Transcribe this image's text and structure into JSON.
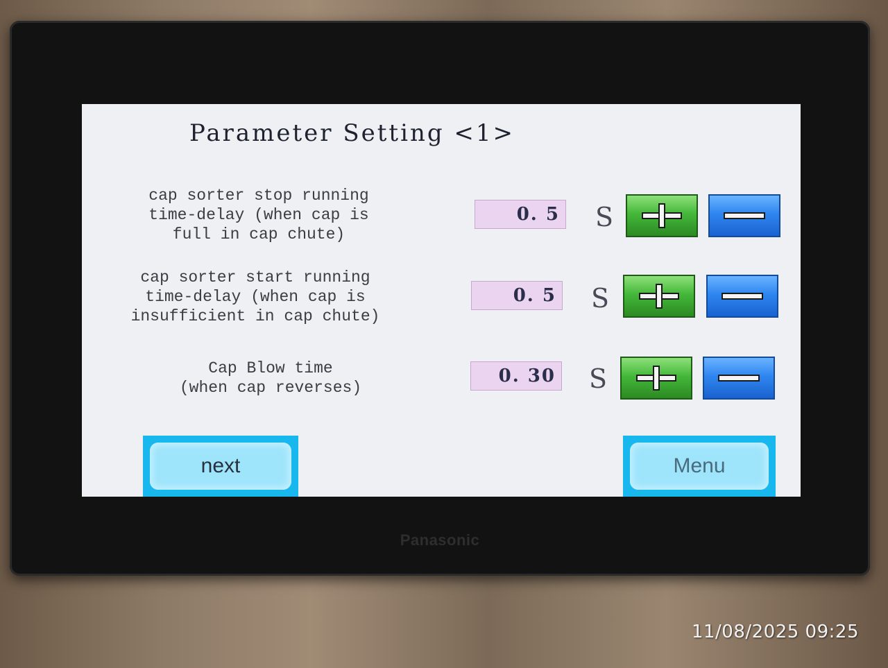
{
  "device": {
    "brand": "Panasonic"
  },
  "screen": {
    "title": "Parameter Setting <1>",
    "params": [
      {
        "label": "cap sorter stop running\ntime-delay (when cap is\nfull in cap chute)",
        "value": "0. 5",
        "unit": "S",
        "increase_icon": "plus-icon",
        "decrease_icon": "minus-icon"
      },
      {
        "label": "cap sorter start running\ntime-delay (when cap is\ninsufficient in cap chute)",
        "value": "0. 5",
        "unit": "S",
        "increase_icon": "plus-icon",
        "decrease_icon": "minus-icon"
      },
      {
        "label": "Cap Blow time\n(when cap reverses)",
        "value": "0. 30",
        "unit": "S",
        "increase_icon": "plus-icon",
        "decrease_icon": "minus-icon"
      }
    ],
    "next_label": "next",
    "menu_label": "Menu"
  },
  "photo": {
    "timestamp": "11/08/2025 09:25"
  },
  "colors": {
    "screen_bg": "#eef0f4",
    "value_box": "#ead4ef",
    "plus_button": "#44b83a",
    "minus_button": "#2f86f0",
    "nav_button": "#18b8ef"
  }
}
